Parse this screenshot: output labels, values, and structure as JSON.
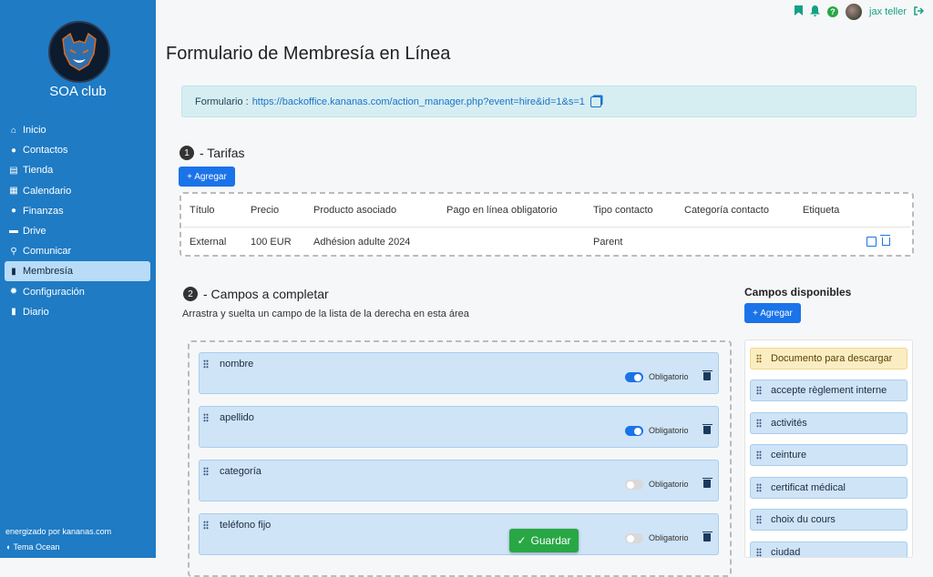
{
  "sidebar": {
    "club_name": "SOA club",
    "items": [
      {
        "label": "Inicio",
        "icon": "home-icon"
      },
      {
        "label": "Contactos",
        "icon": "users-icon"
      },
      {
        "label": "Tienda",
        "icon": "store-icon"
      },
      {
        "label": "Calendario",
        "icon": "calendar-icon"
      },
      {
        "label": "Finanzas",
        "icon": "piggy-bank-icon"
      },
      {
        "label": "Drive",
        "icon": "drive-icon"
      },
      {
        "label": "Comunicar",
        "icon": "broadcast-icon"
      },
      {
        "label": "Membresía",
        "icon": "id-card-icon",
        "active": true
      },
      {
        "label": "Configuración",
        "icon": "gear-icon"
      },
      {
        "label": "Diario",
        "icon": "book-icon"
      }
    ],
    "powered_by": "energizado por kananas.com",
    "theme": "Tema Ocean"
  },
  "topbar": {
    "user": "jax teller"
  },
  "page": {
    "title": "Formulario de Membresía en Línea",
    "form_label": "Formulario :",
    "form_url": "https://backoffice.kananas.com/action_manager.php?event=hire&id=1&s=1"
  },
  "section1": {
    "number": "1",
    "title": "- Tarifas",
    "add_label": "+ Agregar",
    "columns": [
      "Título",
      "Precio",
      "Producto asociado",
      "Pago en línea obligatorio",
      "Tipo contacto",
      "Categoría contacto",
      "Etiqueta"
    ],
    "rows": [
      {
        "titulo": "External",
        "precio": "100 EUR",
        "producto": "Adhésion adulte 2024",
        "pago": "",
        "tipo": "Parent",
        "categoria": "",
        "etiqueta": ""
      }
    ]
  },
  "section2": {
    "number": "2",
    "title": "- Campos a completar",
    "subtitle": "Arrastra y suelta un campo de la lista de la derecha en esta área",
    "fields": [
      {
        "name": "nombre",
        "required": true
      },
      {
        "name": "apellido",
        "required": true
      },
      {
        "name": "categoría",
        "required": false
      },
      {
        "name": "teléfono fijo",
        "required": false
      }
    ],
    "required_label": "Obligatorio"
  },
  "available": {
    "title": "Campos disponibles",
    "add_label": "+ Agregar",
    "items": [
      "Documento para descargar",
      "accepte règlement interne",
      "activités",
      "ceinture",
      "certificat médical",
      "choix du cours",
      "ciudad"
    ]
  },
  "save_label": "Guardar",
  "colors": {
    "sidebar": "#1e7bc4",
    "primary": "#1a73e8",
    "success": "#28a745",
    "topbar_accent": "#16a085"
  }
}
